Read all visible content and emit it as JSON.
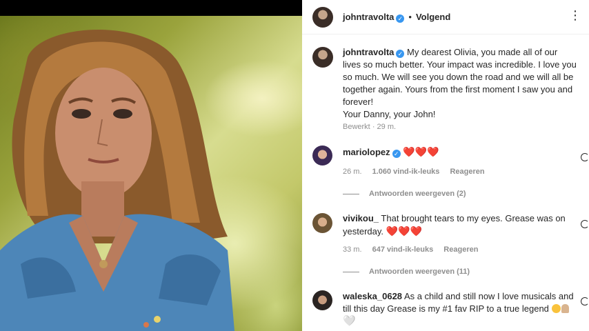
{
  "header": {
    "username": "johntravolta",
    "separator": "•",
    "follow_label": "Volgend",
    "more_icon": "⋮"
  },
  "caption": {
    "username": "johntravolta",
    "text_1": "My dearest Olivia, you made all of our lives so much better. Your impact was incredible. I love you so much. We will see you down the road and we will all be together again. Yours from the first moment I saw you and forever!",
    "text_2": "Your Danny, your John!",
    "edited": "Bewerkt",
    "meta_sep": "·",
    "time": "29 m."
  },
  "comments": [
    {
      "username": "mariolopez",
      "verified": true,
      "text": "",
      "emoji": "❤️❤️❤️",
      "time": "26 m.",
      "likes": "1.060 vind-ik-leuks",
      "reply": "Reageren",
      "view_replies": "Antwoorden weergeven (2)"
    },
    {
      "username": "vivikou_",
      "verified": false,
      "text": "That brought tears to my eyes. Grease was on yesterday.",
      "emoji": "❤️❤️❤️",
      "time": "33 m.",
      "likes": "647 vind-ik-leuks",
      "reply": "Reageren",
      "view_replies": "Antwoorden weergeven (11)"
    },
    {
      "username": "waleska_0628",
      "verified": false,
      "text": "As a child and still now I love musicals and till this day Grease is my #1 fav RIP to a true legend",
      "emoji": "🤍"
    }
  ],
  "icons": {
    "verified": "verified-badge-icon",
    "like": "heart-outline-icon"
  },
  "colors": {
    "verified_blue": "#3897f0",
    "heart_red": "#ed4956",
    "meta_gray": "#8e8e8e"
  }
}
